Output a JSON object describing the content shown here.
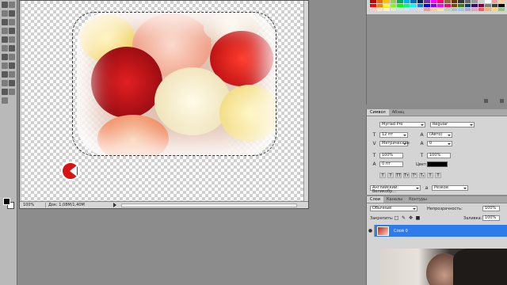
{
  "document": {
    "status": {
      "zoom": "100%",
      "doc_size": "Док: 1,08M/1,40M"
    }
  },
  "character_panel": {
    "tabs": [
      "Символ",
      "Абзац"
    ],
    "font_family": "Myriad Pro",
    "font_style": "Regular",
    "font_size": "12 пт",
    "leading": "(Авто)",
    "kerning": "Метрические",
    "tracking": "0",
    "vertical_scale": "100%",
    "horizontal_scale": "100%",
    "baseline_shift": "0 пт",
    "color_label": "Цвет:",
    "color_value": "#000000",
    "style_buttons": [
      "T",
      "T",
      "TT",
      "Tт",
      "T¹",
      "T₁",
      "T",
      "T"
    ],
    "language": "Английский: Великобр...",
    "antialias": "Резкое"
  },
  "layers_panel": {
    "tabs": [
      "Слои",
      "Каналы",
      "Контуры"
    ],
    "blend_mode": "Обычные",
    "opacity_label": "Непрозрачность:",
    "opacity_value": "100%",
    "lock_label": "Закрепить:",
    "fill_label": "Заливка:",
    "fill_value": "100%",
    "layer_name": "Слой 0"
  },
  "colors": {
    "accent": "#2e7bea",
    "record_button": "#d61414",
    "panel_bg": "#d4d4d4",
    "workspace_bg": "#8c8c8c"
  },
  "icons": {
    "record": "record-rewind-icon",
    "visibility": "eye-icon"
  }
}
